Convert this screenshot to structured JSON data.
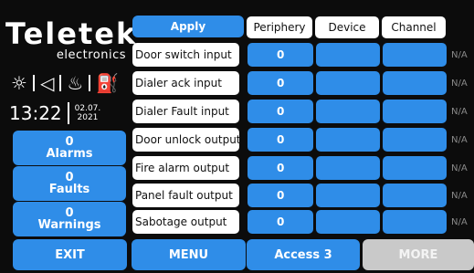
{
  "logo": {
    "brand": "Teletek",
    "subtitle": "electronics"
  },
  "status_icons": [
    {
      "name": "sun-icon",
      "glyph": "☼"
    },
    {
      "name": "sound-icon",
      "glyph": "◁"
    },
    {
      "name": "flame-icon",
      "glyph": "♨"
    },
    {
      "name": "extinguisher-icon",
      "glyph": "⛽"
    }
  ],
  "clock": {
    "time": "13:22",
    "date_line1": "02.07.",
    "date_line2": "2021"
  },
  "counters": {
    "alarms": {
      "count": "0",
      "label": "Alarms"
    },
    "faults": {
      "count": "0",
      "label": "Faults"
    },
    "warnings": {
      "count": "0",
      "label": "Warnings"
    }
  },
  "apply_label": "Apply",
  "columns": {
    "periphery": "Periphery",
    "device": "Device",
    "channel": "Channel"
  },
  "rows": [
    {
      "label": "Door switch input",
      "periphery": "0",
      "device": "",
      "channel": "",
      "na": "N/A"
    },
    {
      "label": "Dialer ack input",
      "periphery": "0",
      "device": "",
      "channel": "",
      "na": "N/A"
    },
    {
      "label": "Dialer Fault input",
      "periphery": "0",
      "device": "",
      "channel": "",
      "na": "N/A"
    },
    {
      "label": "Door unlock output",
      "periphery": "0",
      "device": "",
      "channel": "",
      "na": "N/A"
    },
    {
      "label": "Fire alarm output",
      "periphery": "0",
      "device": "",
      "channel": "",
      "na": "N/A"
    },
    {
      "label": "Panel fault output",
      "periphery": "0",
      "device": "",
      "channel": "",
      "na": "N/A"
    },
    {
      "label": "Sabotage output",
      "periphery": "0",
      "device": "",
      "channel": "",
      "na": "N/A"
    }
  ],
  "bottom_bar": {
    "exit": "EXIT",
    "menu": "MENU",
    "access": "Access 3",
    "more": "MORE"
  },
  "colors": {
    "accent": "#2f8de8",
    "background": "#0c0c0c",
    "disabled": "#c9c9c9"
  }
}
